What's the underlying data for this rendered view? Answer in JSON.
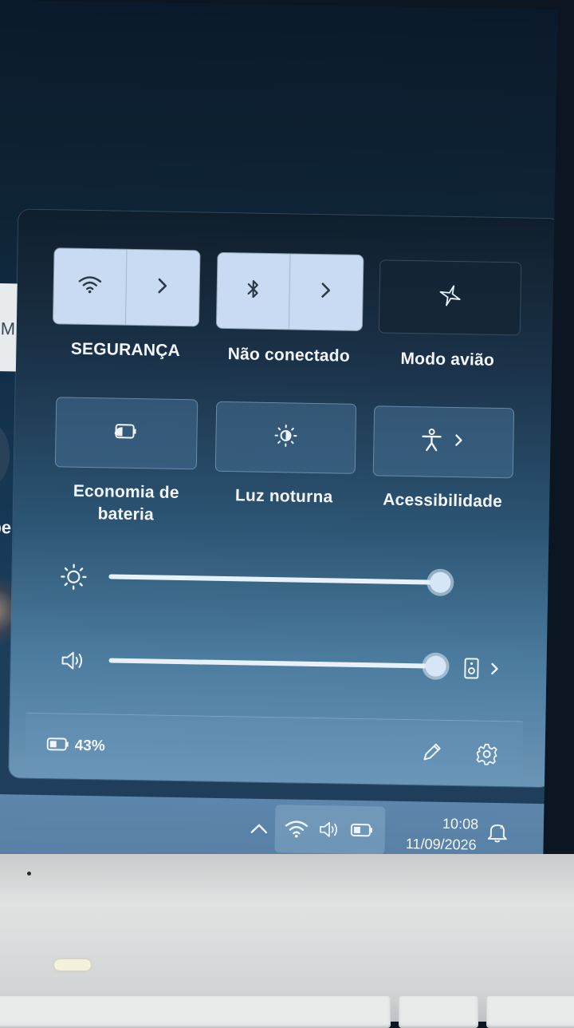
{
  "background": {
    "window_letter": "M",
    "text_fragment": "be"
  },
  "quick_settings": {
    "tiles_row1": [
      {
        "label": "SEGURANÇA",
        "icon": "wifi-icon",
        "state": "on",
        "expandable": true
      },
      {
        "label": "Não conectado",
        "icon": "bluetooth-icon",
        "state": "on",
        "expandable": true
      },
      {
        "label": "Modo avião",
        "icon": "airplane-icon",
        "state": "off",
        "expandable": false
      }
    ],
    "tiles_row2": [
      {
        "label_line1": "Economia de",
        "label_line2": "bateria",
        "icon": "battery-saver-icon",
        "state": "off"
      },
      {
        "label": "Luz noturna",
        "icon": "night-light-icon",
        "state": "off"
      },
      {
        "label": "Acessibilidade",
        "icon": "accessibility-icon",
        "state": "off",
        "expandable": true
      }
    ],
    "brightness": {
      "icon": "brightness-icon",
      "level": 1.0
    },
    "volume": {
      "icon": "speaker-icon",
      "level": 1.0,
      "output_icon": "speaker-output-icon"
    },
    "footer": {
      "battery_percent": "43%",
      "edit_icon": "pencil-icon",
      "settings_icon": "gear-icon"
    }
  },
  "taskbar": {
    "tray_icons": [
      "chevron-up-icon",
      "wifi-icon",
      "speaker-icon",
      "battery-icon"
    ],
    "time": "10:08",
    "date": "11/09/2026",
    "notification_icon": "notification-bell-icon"
  },
  "colors": {
    "tile_on": "#c8dbf2",
    "text": "#f2f6fa"
  }
}
